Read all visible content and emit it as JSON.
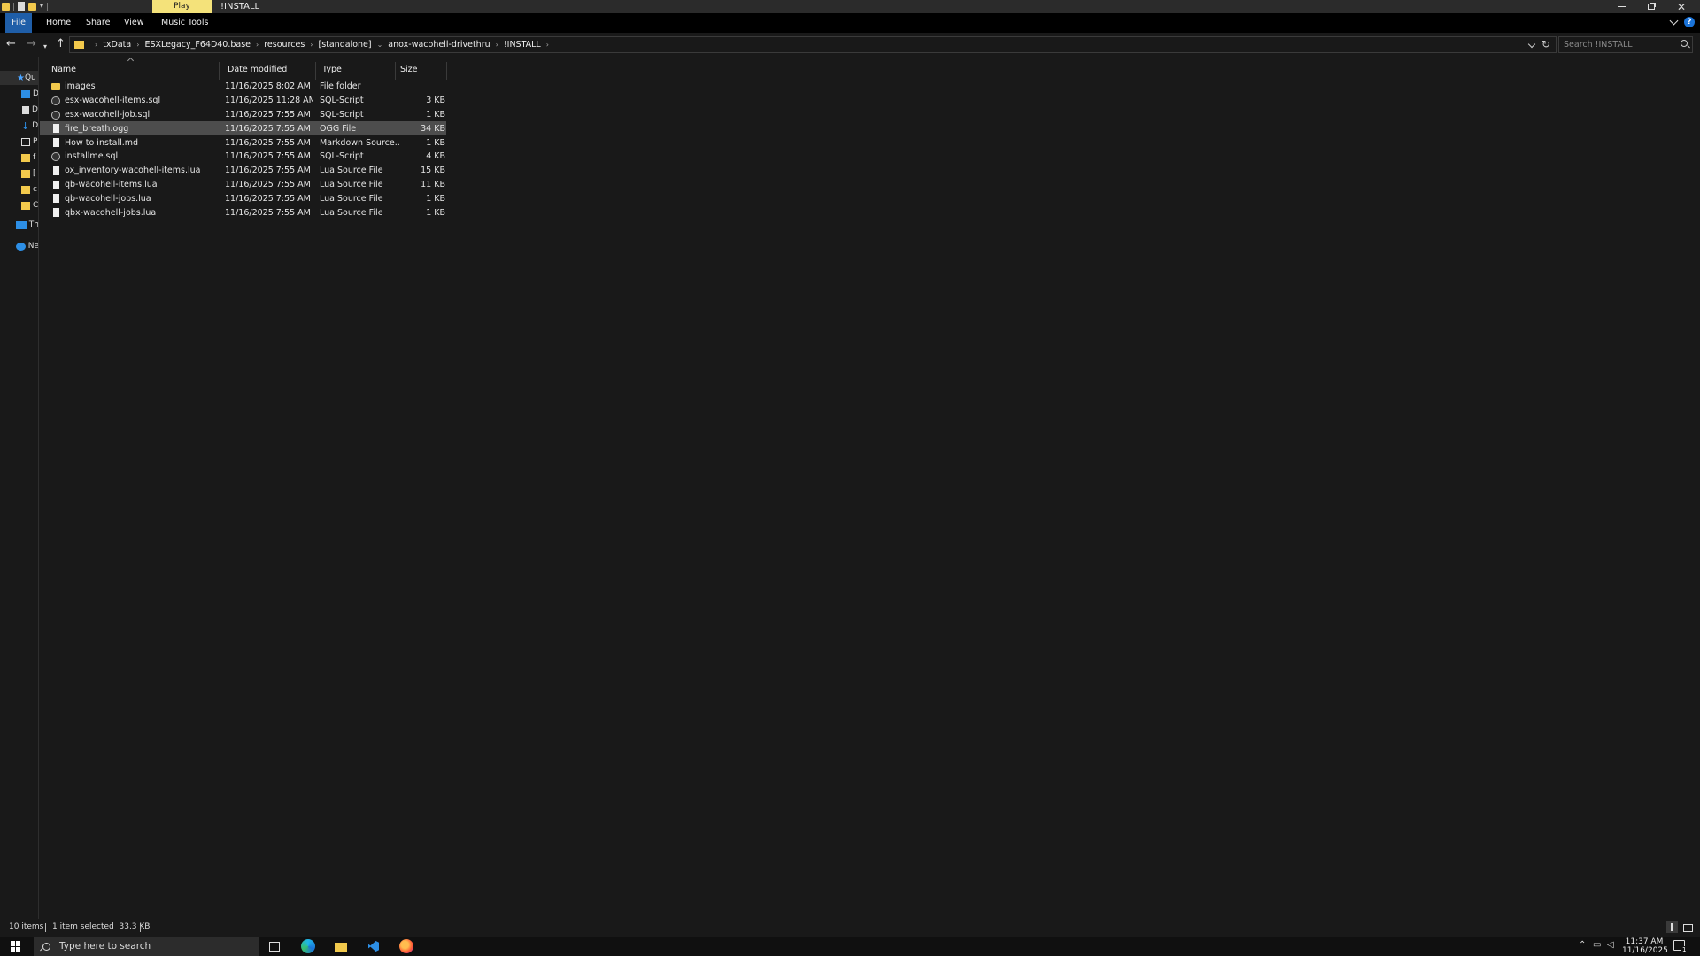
{
  "window": {
    "title": "!INSTALL",
    "context_tab": "Play"
  },
  "ribbon": {
    "tabs": [
      "File",
      "Home",
      "Share",
      "View",
      "Music Tools"
    ]
  },
  "address": {
    "breadcrumbs": [
      "txData",
      "ESXLegacy_F64D40.base",
      "resources",
      "[standalone]",
      "anox-wacohell-drivethru",
      "!INSTALL"
    ]
  },
  "search": {
    "placeholder": "Search !INSTALL"
  },
  "navpane": {
    "items": [
      "Qu",
      "D",
      "D",
      "D",
      "P",
      "f",
      "[",
      "c",
      "C",
      "Th",
      "Ne"
    ]
  },
  "columns": {
    "name": "Name",
    "date": "Date modified",
    "type": "Type",
    "size": "Size"
  },
  "files": [
    {
      "name": "images",
      "date": "11/16/2025 8:02 AM",
      "type": "File folder",
      "size": "",
      "icon": "folder-icon"
    },
    {
      "name": "esx-wacohell-items.sql",
      "date": "11/16/2025 11:28 AM",
      "type": "SQL-Script",
      "size": "3 KB",
      "icon": "sql-file-icon"
    },
    {
      "name": "esx-wacohell-job.sql",
      "date": "11/16/2025 7:55 AM",
      "type": "SQL-Script",
      "size": "1 KB",
      "icon": "sql-file-icon"
    },
    {
      "name": "fire_breath.ogg",
      "date": "11/16/2025 7:55 AM",
      "type": "OGG File",
      "size": "34 KB",
      "icon": "file-icon"
    },
    {
      "name": "How to install.md",
      "date": "11/16/2025 7:55 AM",
      "type": "Markdown Source...",
      "size": "1 KB",
      "icon": "file-icon"
    },
    {
      "name": "installme.sql",
      "date": "11/16/2025 7:55 AM",
      "type": "SQL-Script",
      "size": "4 KB",
      "icon": "sql-file-icon"
    },
    {
      "name": "ox_inventory-wacohell-items.lua",
      "date": "11/16/2025 7:55 AM",
      "type": "Lua Source File",
      "size": "15 KB",
      "icon": "file-icon"
    },
    {
      "name": "qb-wacohell-items.lua",
      "date": "11/16/2025 7:55 AM",
      "type": "Lua Source File",
      "size": "11 KB",
      "icon": "file-icon"
    },
    {
      "name": "qb-wacohell-jobs.lua",
      "date": "11/16/2025 7:55 AM",
      "type": "Lua Source File",
      "size": "1 KB",
      "icon": "file-icon"
    },
    {
      "name": "qbx-wacohell-jobs.lua",
      "date": "11/16/2025 7:55 AM",
      "type": "Lua Source File",
      "size": "1 KB",
      "icon": "file-icon"
    }
  ],
  "selected_index": 3,
  "status": {
    "item_count": "10 items",
    "selection": "1 item selected  33.3 KB"
  },
  "taskbar": {
    "search_placeholder": "Type here to search",
    "time": "11:37 AM",
    "date": "11/16/2025",
    "notification_count": "1"
  },
  "colors": {
    "folder": "#f2c94c",
    "accent": "#1a73d9",
    "selected_row": "#4d4d4d",
    "context_tab": "#f4e27a"
  }
}
